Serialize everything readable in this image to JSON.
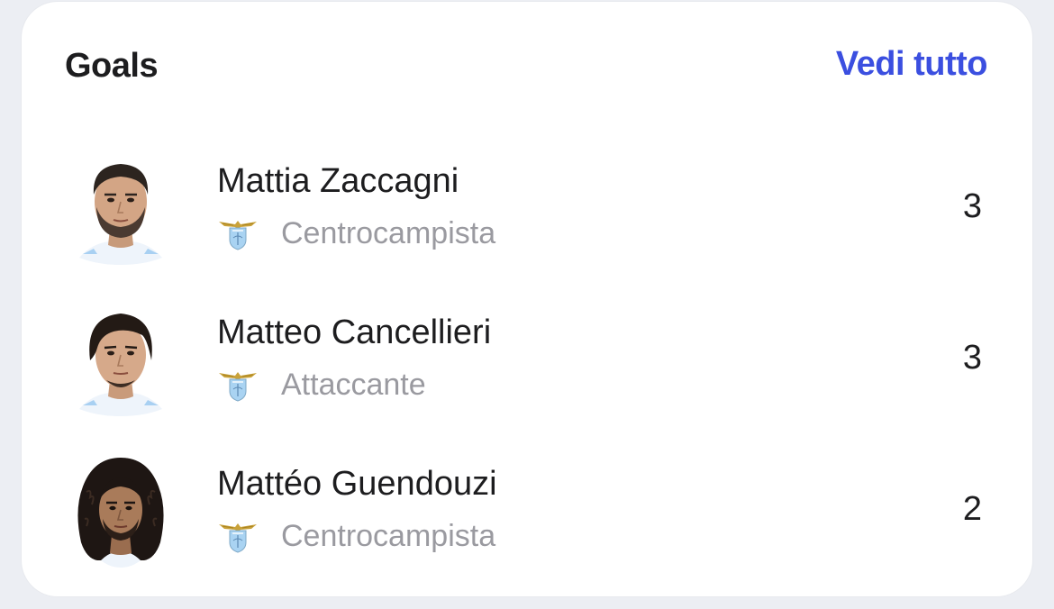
{
  "card": {
    "title": "Goals",
    "see_all_label": "Vedi tutto"
  },
  "players": [
    {
      "name": "Mattia Zaccagni",
      "position": "Centrocampista",
      "goals": "3"
    },
    {
      "name": "Matteo Cancellieri",
      "position": "Attaccante",
      "goals": "3"
    },
    {
      "name": "Mattéo Guendouzi",
      "position": "Centrocampista",
      "goals": "2"
    }
  ],
  "colors": {
    "accent": "#3b4fe0",
    "text": "#1d1d1f",
    "muted": "#9a9aa0",
    "background": "#eceef3",
    "card": "#ffffff"
  }
}
